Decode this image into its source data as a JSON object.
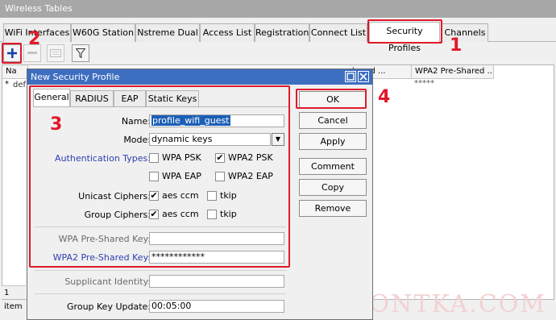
{
  "window": {
    "title": "Wireless Tables"
  },
  "tabs": [
    "WiFi Interfaces",
    "W60G Station",
    "Nstreme Dual",
    "Access List",
    "Registration",
    "Connect List",
    "Security Profiles",
    "Channels"
  ],
  "table": {
    "col_name_partial": "Na",
    "col_wpa_partial": "hared ...",
    "col_wpa2": "WPA2 Pre-Shared ...",
    "row_marker": "*",
    "row_name_partial": "def",
    "row_wpa2": "*****",
    "status": "1 item"
  },
  "watermark": "REMONTKA.COM",
  "dialog": {
    "title": "New Security Profile",
    "tabs": [
      "General",
      "RADIUS",
      "EAP",
      "Static Keys"
    ],
    "name_label": "Name:",
    "name_value": "profile_wifi_guest",
    "mode_label": "Mode:",
    "mode_value": "dynamic keys",
    "auth_label": "Authentication Types:",
    "auth_options": [
      {
        "label": "WPA PSK",
        "checked": false
      },
      {
        "label": "WPA2 PSK",
        "checked": true
      },
      {
        "label": "WPA EAP",
        "checked": false
      },
      {
        "label": "WPA2 EAP",
        "checked": false
      }
    ],
    "unicast_label": "Unicast Ciphers:",
    "unicast_options": [
      {
        "label": "aes ccm",
        "checked": true
      },
      {
        "label": "tkip",
        "checked": false
      }
    ],
    "group_label": "Group Ciphers:",
    "group_options": [
      {
        "label": "aes ccm",
        "checked": true
      },
      {
        "label": "tkip",
        "checked": false
      }
    ],
    "wpa_key_label": "WPA Pre-Shared Key:",
    "wpa_key_value": "",
    "wpa2_key_label": "WPA2 Pre-Shared Key:",
    "wpa2_key_value": "************",
    "supplicant_label": "Supplicant Identity:",
    "supplicant_value": "",
    "group_key_label": "Group Key Update:",
    "group_key_value": "00:05:00",
    "buttons": [
      "OK",
      "Cancel",
      "Apply",
      "Comment",
      "Copy",
      "Remove"
    ]
  },
  "annotations": {
    "n1": "1",
    "n2": "2",
    "n3": "3",
    "n4": "4"
  },
  "colors": {
    "annotation": "#e0192a",
    "title_bar": "#3d6ec0",
    "blue_label": "#2d3eaf"
  }
}
